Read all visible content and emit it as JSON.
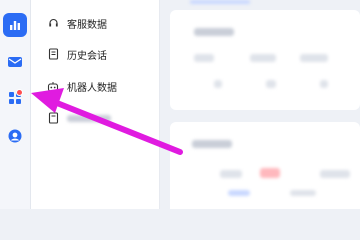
{
  "accent_color": "#2b6cf4",
  "annotation_color": "#e01be0",
  "rail": {
    "items": [
      {
        "icon": "bar-chart-icon",
        "active": true
      },
      {
        "icon": "mail-icon",
        "active": false
      },
      {
        "icon": "apps-grid-icon",
        "active": false,
        "badge": true
      },
      {
        "icon": "agent-headset-icon",
        "active": false
      }
    ]
  },
  "submenu": {
    "items": [
      {
        "label": "客服数据",
        "icon": "headset-icon"
      },
      {
        "label": "历史会话",
        "icon": "document-icon"
      },
      {
        "label": "机器人数据",
        "icon": "robot-icon"
      },
      {
        "label": "",
        "icon": "document-icon"
      }
    ]
  }
}
